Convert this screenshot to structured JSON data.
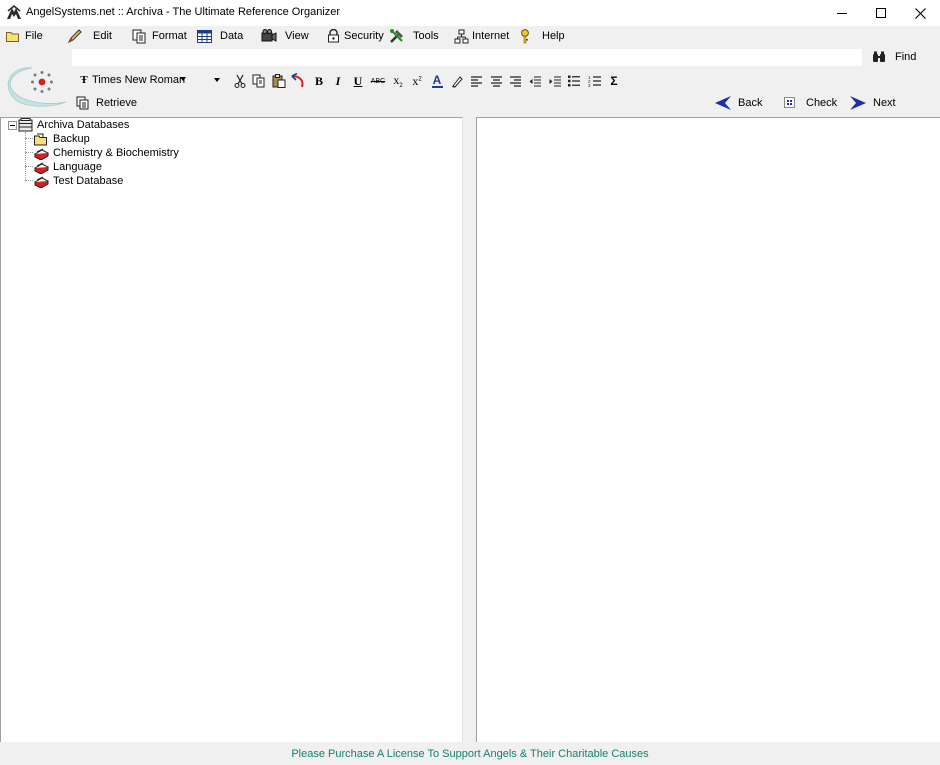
{
  "window": {
    "title": "AngelSystems.net :: Archiva - The Ultimate Reference Organizer",
    "controls": {
      "minimize": "minimize-icon",
      "maximize": "maximize-icon",
      "close": "close-icon"
    }
  },
  "menu": {
    "items": [
      {
        "label": "File",
        "icon": "folder-icon"
      },
      {
        "label": "Edit",
        "icon": "pencil-icon"
      },
      {
        "label": "Format",
        "icon": "format-pages-icon"
      },
      {
        "label": "Data",
        "icon": "table-grid-icon"
      },
      {
        "label": "View",
        "icon": "camera-view-icon"
      },
      {
        "label": "Security",
        "icon": "padlock-icon"
      },
      {
        "label": "Tools",
        "icon": "tools-icon"
      },
      {
        "label": "Internet",
        "icon": "network-icon"
      },
      {
        "label": "Help",
        "icon": "key-help-icon"
      }
    ]
  },
  "search": {
    "value": "",
    "find_label": "Find"
  },
  "format_toolbar": {
    "font_name": "Times New Roman",
    "font_size": "",
    "buttons": [
      "cut-icon",
      "copy-icon",
      "paste-icon",
      "undo-icon",
      "bold-icon",
      "italic-icon",
      "underline-icon",
      "strikethrough-icon",
      "subscript-icon",
      "superscript-icon",
      "font-color-icon",
      "highlight-icon",
      "align-left-icon",
      "align-center-icon",
      "align-right-icon",
      "outdent-icon",
      "indent-icon",
      "bullet-list-icon",
      "numbered-list-icon",
      "sigma-icon"
    ],
    "glyphs": {
      "bold": "B",
      "italic": "I",
      "underline": "U",
      "strike": "ABC",
      "subscript": "x",
      "superscript": "x",
      "font_color": "A",
      "sigma": "Σ"
    }
  },
  "retrieve_label": "Retrieve",
  "navigation": {
    "back_label": "Back",
    "check_label": "Check",
    "next_label": "Next"
  },
  "tree": {
    "root": "Archiva Databases",
    "children": [
      "Backup",
      "Chemistry & Biochemistry",
      "Language",
      "Test Database"
    ]
  },
  "status": {
    "message": "Please Purchase A License To Support Angels & Their Charitable Causes",
    "message_color": "#16806f"
  }
}
